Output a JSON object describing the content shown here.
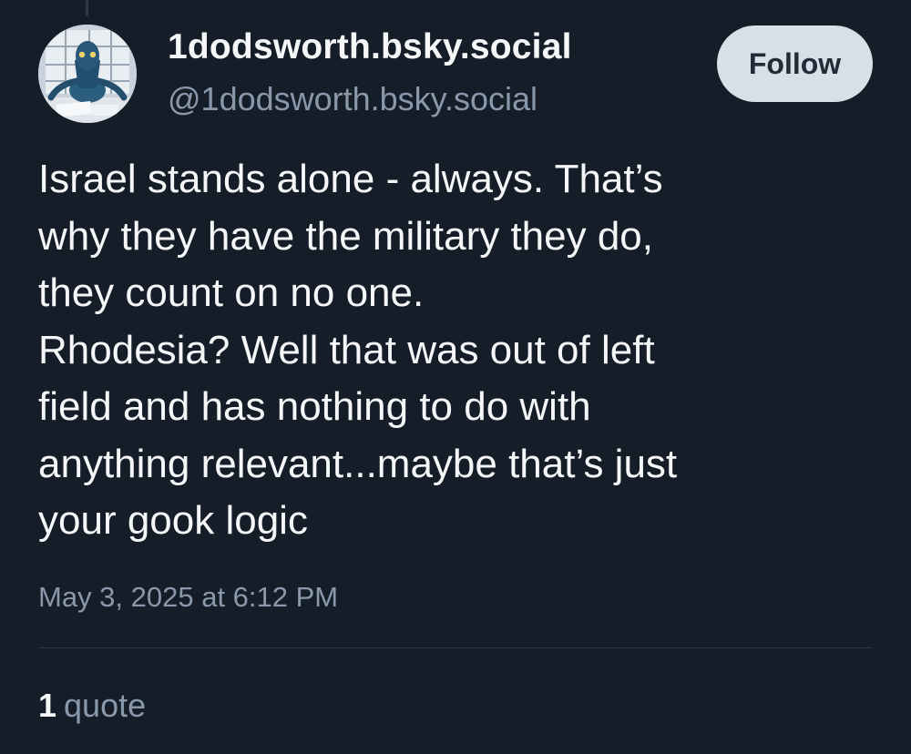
{
  "author": {
    "display_name": "1dodsworth.bsky.social",
    "handle": "@1dodsworth.bsky.social",
    "avatar_icon": "alien-figure-avatar"
  },
  "follow_button": {
    "label": "Follow"
  },
  "post": {
    "lines": [
      "Israel stands alone - always. That’s",
      "why they have the military they do,",
      "they count on no one.",
      "Rhodesia? Well that was out of left",
      "field and has nothing to do with",
      "anything relevant...maybe that’s just",
      "your gook logic"
    ],
    "timestamp": "May 3, 2025 at 6:12 PM"
  },
  "stats": {
    "quote_count": "1",
    "quote_label": "quote"
  },
  "colors": {
    "background": "#151d28",
    "text_primary": "#f4f6f8",
    "text_secondary": "#8a98ab",
    "follow_button_bg": "#d9dfe6",
    "divider": "#2a3444"
  }
}
